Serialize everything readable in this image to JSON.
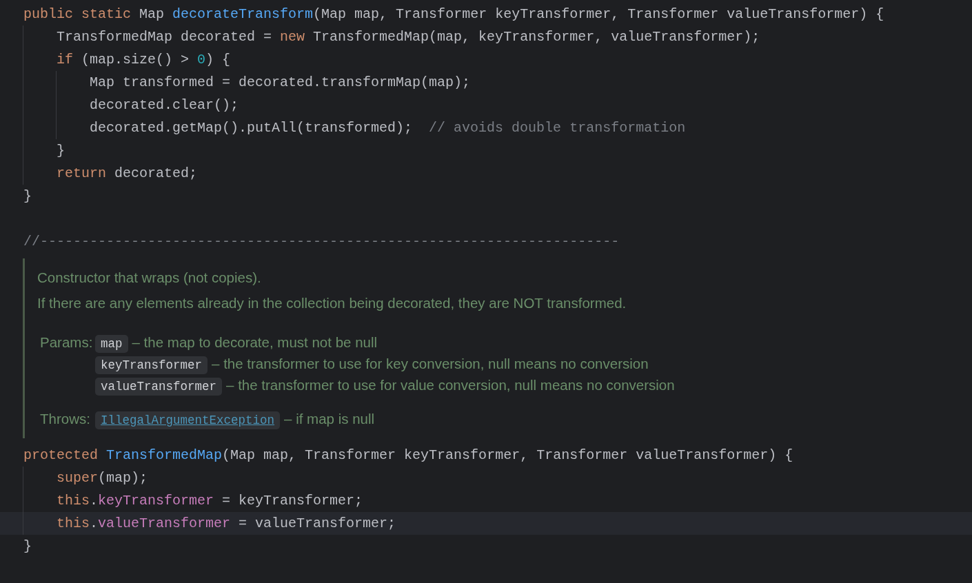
{
  "code_top": [
    {
      "current": false,
      "tokens": [
        {
          "kind": "keyword",
          "text": "public static"
        },
        {
          "kind": "plain",
          "text": " Map "
        },
        {
          "kind": "method",
          "text": "decorateTransform"
        },
        {
          "kind": "plain",
          "text": "(Map map, Transformer keyTransformer, Transformer valueTransformer) {"
        }
      ],
      "children": [
        {
          "current": false,
          "tokens": [
            {
              "kind": "plain",
              "text": "TransformedMap decorated = "
            },
            {
              "kind": "keyword",
              "text": "new"
            },
            {
              "kind": "plain",
              "text": " TransformedMap(map, keyTransformer, valueTransformer);"
            }
          ]
        },
        {
          "current": false,
          "tokens": [
            {
              "kind": "keyword",
              "text": "if"
            },
            {
              "kind": "plain",
              "text": " (map.size() > "
            },
            {
              "kind": "number",
              "text": "0"
            },
            {
              "kind": "plain",
              "text": ") {"
            }
          ],
          "children": [
            {
              "current": false,
              "tokens": [
                {
                  "kind": "plain",
                  "text": "Map transformed = decorated.transformMap(map);"
                }
              ]
            },
            {
              "current": false,
              "tokens": [
                {
                  "kind": "plain",
                  "text": "decorated.clear();"
                }
              ]
            },
            {
              "current": false,
              "tokens": [
                {
                  "kind": "plain",
                  "text": "decorated.getMap().putAll(transformed);  "
                },
                {
                  "kind": "comment",
                  "text": "// avoids double transformation"
                }
              ]
            }
          ]
        },
        {
          "current": false,
          "tokens": [
            {
              "kind": "plain",
              "text": "}"
            }
          ]
        },
        {
          "current": false,
          "tokens": [
            {
              "kind": "keyword",
              "text": "return"
            },
            {
              "kind": "plain",
              "text": " decorated;"
            }
          ]
        }
      ]
    },
    {
      "current": false,
      "tokens": [
        {
          "kind": "plain",
          "text": "}"
        }
      ]
    }
  ],
  "separator_comment": {
    "current": false,
    "tokens": [
      {
        "kind": "comment",
        "text": "//----------------------------------------------------------------------"
      }
    ]
  },
  "doc": {
    "paragraphs": [
      "Constructor that wraps (not copies).",
      "If there are any elements already in the collection being decorated, they are NOT transformed."
    ],
    "params_label": "Params:",
    "params": [
      {
        "name": "map",
        "description": "– the map to decorate, must not be null"
      },
      {
        "name": "keyTransformer",
        "description": "– the transformer to use for key conversion, null means no conversion"
      },
      {
        "name": "valueTransformer",
        "description": "– the transformer to use for value conversion, null means no conversion"
      }
    ],
    "throws_label": "Throws:",
    "throws": [
      {
        "name": "IllegalArgumentException",
        "description": "– if map is null"
      }
    ]
  },
  "code_bottom": [
    {
      "current": false,
      "tokens": [
        {
          "kind": "keyword",
          "text": "protected"
        },
        {
          "kind": "method",
          "text": " TransformedMap"
        },
        {
          "kind": "plain",
          "text": "(Map map, Transformer keyTransformer, Transformer valueTransformer) {"
        }
      ],
      "children": [
        {
          "current": false,
          "tokens": [
            {
              "kind": "keyword",
              "text": "super"
            },
            {
              "kind": "plain",
              "text": "(map);"
            }
          ]
        },
        {
          "current": false,
          "tokens": [
            {
              "kind": "keyword",
              "text": "this"
            },
            {
              "kind": "plain",
              "text": "."
            },
            {
              "kind": "field",
              "text": "keyTransformer"
            },
            {
              "kind": "plain",
              "text": " = keyTransformer;"
            }
          ]
        },
        {
          "current": true,
          "tokens": [
            {
              "kind": "keyword",
              "text": "this"
            },
            {
              "kind": "plain",
              "text": "."
            },
            {
              "kind": "field",
              "text": "valueTransformer"
            },
            {
              "kind": "plain",
              "text": " = valueTransformer;"
            }
          ]
        }
      ]
    },
    {
      "current": false,
      "tokens": [
        {
          "kind": "plain",
          "text": "}"
        }
      ]
    }
  ]
}
